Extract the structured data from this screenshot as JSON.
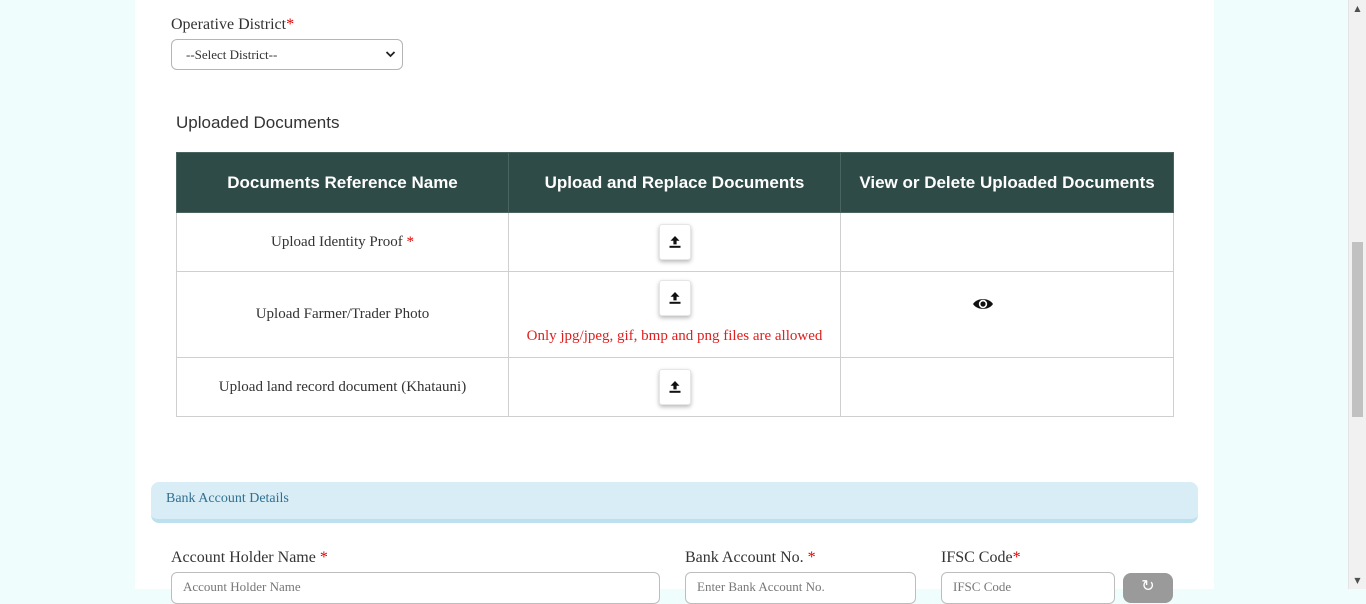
{
  "district": {
    "label": "Operative District",
    "required_mark": "*",
    "selected": "--Select District--"
  },
  "documents": {
    "title": "Uploaded Documents",
    "headers": [
      "Documents Reference Name",
      "Upload and Replace Documents",
      "View or Delete Uploaded Documents"
    ],
    "rows": [
      {
        "name": "Upload Identity Proof",
        "required_mark": "*",
        "icon": "upload-icon",
        "note": "",
        "view_icon": ""
      },
      {
        "name": "Upload Farmer/Trader Photo",
        "required_mark": "",
        "icon": "upload-icon",
        "note": "Only jpg/jpeg, gif, bmp and png files are allowed",
        "view_icon": "eye-icon"
      },
      {
        "name": "Upload land record document (Khatauni)",
        "required_mark": "",
        "icon": "upload-icon",
        "note": "",
        "view_icon": ""
      }
    ]
  },
  "bank": {
    "section_title": "Bank Account Details",
    "holder_label": "Account Holder Name",
    "holder_required": "*",
    "holder_placeholder": "Account Holder Name",
    "account_label": "Bank Account No.",
    "account_required": "*",
    "account_placeholder": "Enter Bank Account No.",
    "ifsc_label": "IFSC Code",
    "ifsc_required": "*",
    "ifsc_placeholder": "IFSC Code"
  },
  "colors": {
    "header_bg": "#2f4b47",
    "required": "#e00000",
    "bank_bar_bg": "#d9edf7",
    "page_bg": "#f0fdfd"
  }
}
